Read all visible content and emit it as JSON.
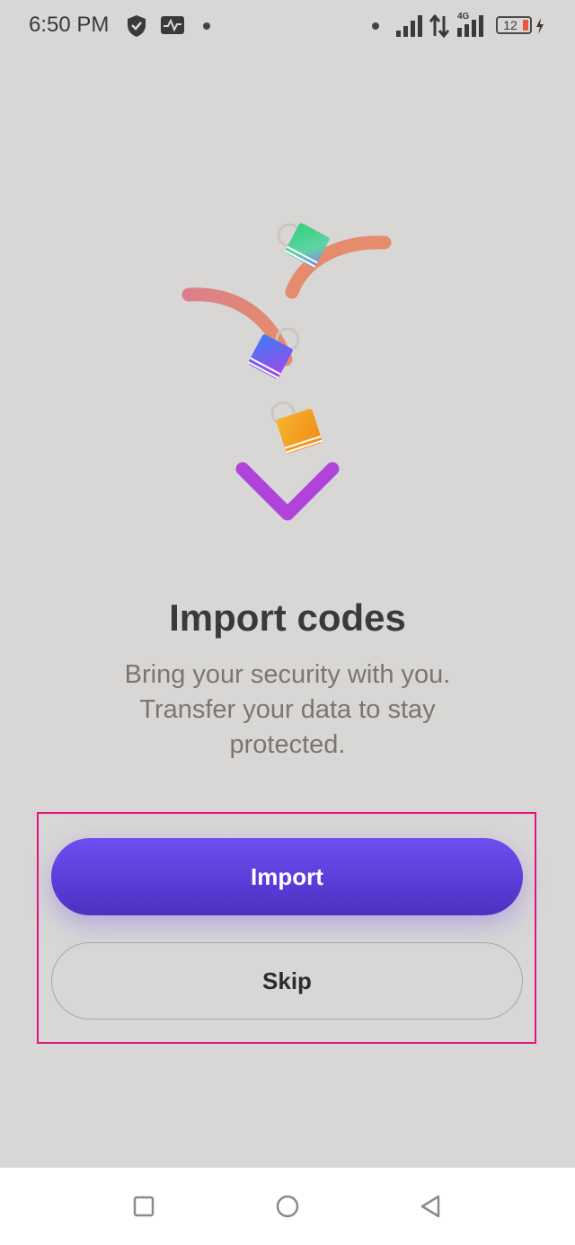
{
  "status_bar": {
    "time": "6:50 PM",
    "network_type": "4G",
    "battery_level": "12",
    "icons": [
      "shield-icon",
      "activity-monitor-icon",
      "notification-dot",
      "signal-icon",
      "data-transfer-icon",
      "signal-4g-icon",
      "battery-icon",
      "charging-icon"
    ]
  },
  "illustration": {
    "name": "import-arrow-with-lock-icons",
    "colors": {
      "stem_top": "#e48c6c",
      "stem_bottom": "#b046d8",
      "arrow": "#b044da",
      "lock_green": "#2ad07a",
      "lock_blue": "#4a6cf5",
      "lock_orange": "#f3a51e"
    }
  },
  "content": {
    "title": "Import codes",
    "subtitle": "Bring your security with you. Transfer your data to stay protected."
  },
  "actions": {
    "import_label": "Import",
    "skip_label": "Skip"
  },
  "nav_bar": {
    "icons": [
      "recent-apps-icon",
      "home-icon",
      "back-icon"
    ]
  },
  "colors": {
    "background": "#d8d7d6",
    "primary_button": "#5f41e0",
    "highlight_border": "#e0157f"
  }
}
